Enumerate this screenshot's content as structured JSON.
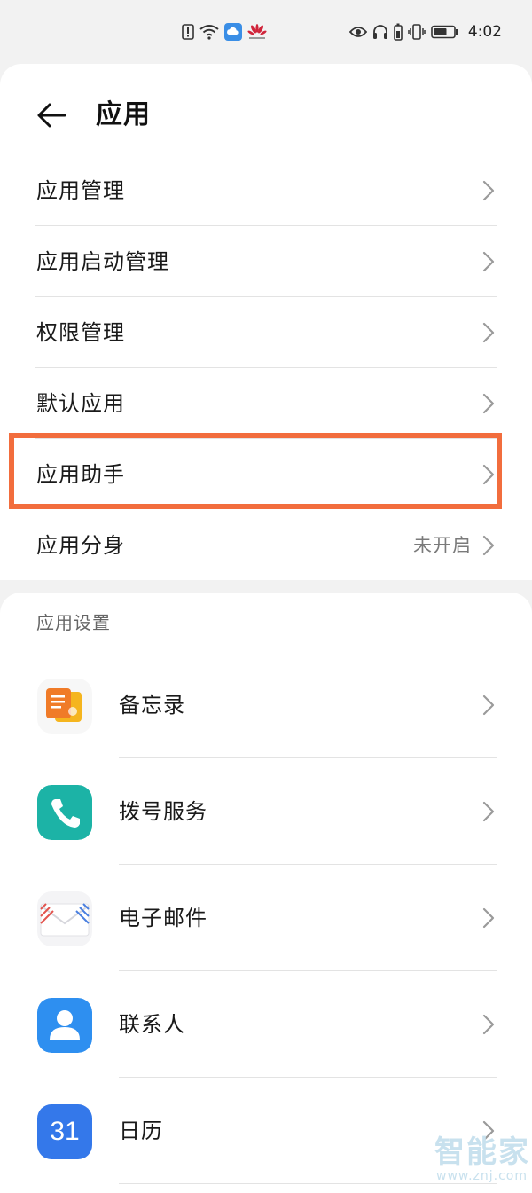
{
  "status_bar": {
    "time": "4:02",
    "left_icons": [
      "alert-icon",
      "wifi-icon",
      "cloud-icon",
      "huawei-icon"
    ],
    "right_icons": [
      "eye-icon",
      "headphones-icon",
      "battery-saver-icon",
      "vibrate-icon",
      "battery-icon"
    ]
  },
  "header": {
    "title": "应用",
    "back_icon": "back-arrow-icon"
  },
  "menu": {
    "items": [
      {
        "label": "应用管理",
        "value": ""
      },
      {
        "label": "应用启动管理",
        "value": ""
      },
      {
        "label": "权限管理",
        "value": ""
      },
      {
        "label": "默认应用",
        "value": ""
      },
      {
        "label": "应用助手",
        "value": "",
        "highlighted": true
      },
      {
        "label": "应用分身",
        "value": "未开启"
      }
    ]
  },
  "app_settings": {
    "header": "应用设置",
    "apps": [
      {
        "label": "备忘录",
        "icon": "notepad-icon"
      },
      {
        "label": "拨号服务",
        "icon": "phone-icon"
      },
      {
        "label": "电子邮件",
        "icon": "email-icon"
      },
      {
        "label": "联系人",
        "icon": "contacts-icon"
      },
      {
        "label": "日历",
        "icon": "calendar-icon",
        "icon_text": "31"
      }
    ]
  },
  "watermark": {
    "big": "智能家",
    "small": "www.znj.com"
  },
  "colors": {
    "highlight": "#f26d3d",
    "background": "#f2f2f2",
    "card": "#ffffff"
  }
}
